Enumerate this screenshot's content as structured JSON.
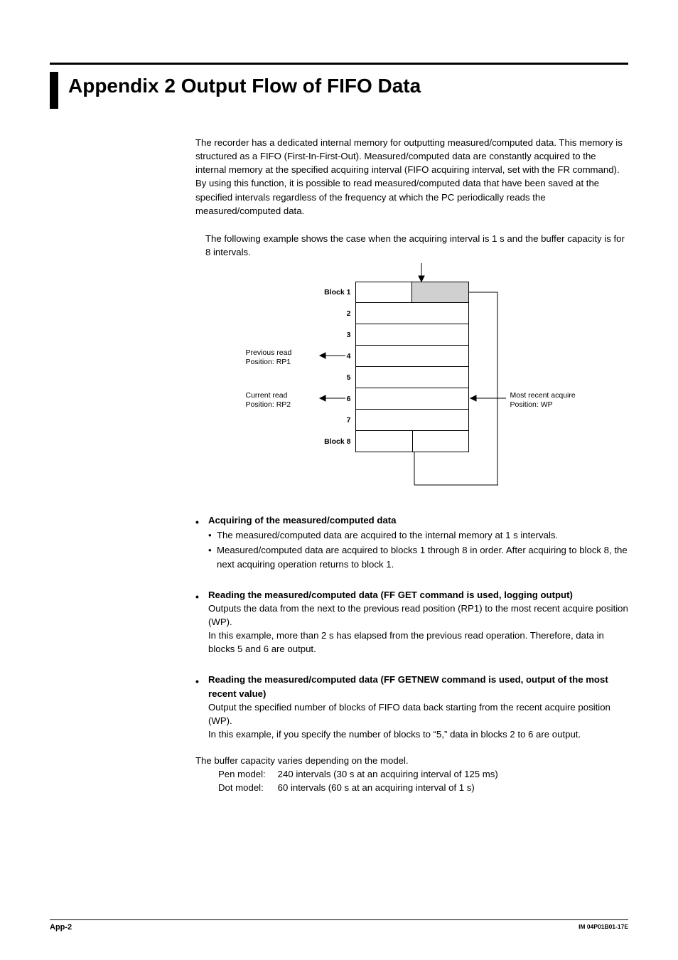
{
  "title": "Appendix 2  Output Flow of FIFO Data",
  "intro": "The recorder has a dedicated internal memory for outputting measured/computed data. This memory is structured as a FIFO (First-In-First-Out). Measured/computed data are constantly acquired to the internal memory at the specified acquiring interval (FIFO acquiring interval, set with the FR command). By using this function, it is possible to read measured/computed data that have been saved at the specified intervals regardless of the frequency at which the PC periodically reads the measured/computed data.",
  "example_intro": "The following example shows the case when the acquiring interval is 1 s and the buffer capacity is for 8 intervals.",
  "diagram": {
    "block1_label": "Block 1",
    "r2": "2",
    "r3": "3",
    "r4": "4",
    "r5": "5",
    "r6": "6",
    "r7": "7",
    "block8_label": "Block 8",
    "prev_read_l1": "Previous read",
    "prev_read_l2": "Position: RP1",
    "curr_read_l1": "Current read",
    "curr_read_l2": "Position: RP2",
    "recent_l1": "Most recent acquire",
    "recent_l2": "Position: WP"
  },
  "sec1": {
    "head": "Acquiring of the measured/computed data",
    "b1": "The measured/computed data are acquired to the internal memory at 1 s intervals.",
    "b2": "Measured/computed data are acquired to blocks 1 through 8 in order. After acquiring to block 8, the next acquiring operation returns to block 1."
  },
  "sec2": {
    "head": "Reading the measured/computed data (FF GET command is used, logging output)",
    "p1": "Outputs the data from the next to the previous read position (RP1) to the most recent acquire position (WP).",
    "p2": "In this example, more than 2 s has elapsed from the previous read operation. Therefore, data in blocks 5 and 6 are output."
  },
  "sec3": {
    "head": "Reading the measured/computed data (FF GETNEW command is used, output of the most recent value)",
    "p1": "Output the specified number of blocks of FIFO data back starting from the recent acquire position (WP).",
    "p2": "In this example, if you specify the number of blocks to “5,” data in blocks 2 to 6 are output."
  },
  "buffer_line": "The buffer capacity varies depending on the model.",
  "pen_label": "Pen model:",
  "pen_val": "240 intervals (30 s at an acquiring interval of 125 ms)",
  "dot_label": "Dot model:",
  "dot_val": "60 intervals (60 s at an acquiring interval of 1 s)",
  "footer_page": "App-2",
  "footer_doc": "IM 04P01B01-17E"
}
